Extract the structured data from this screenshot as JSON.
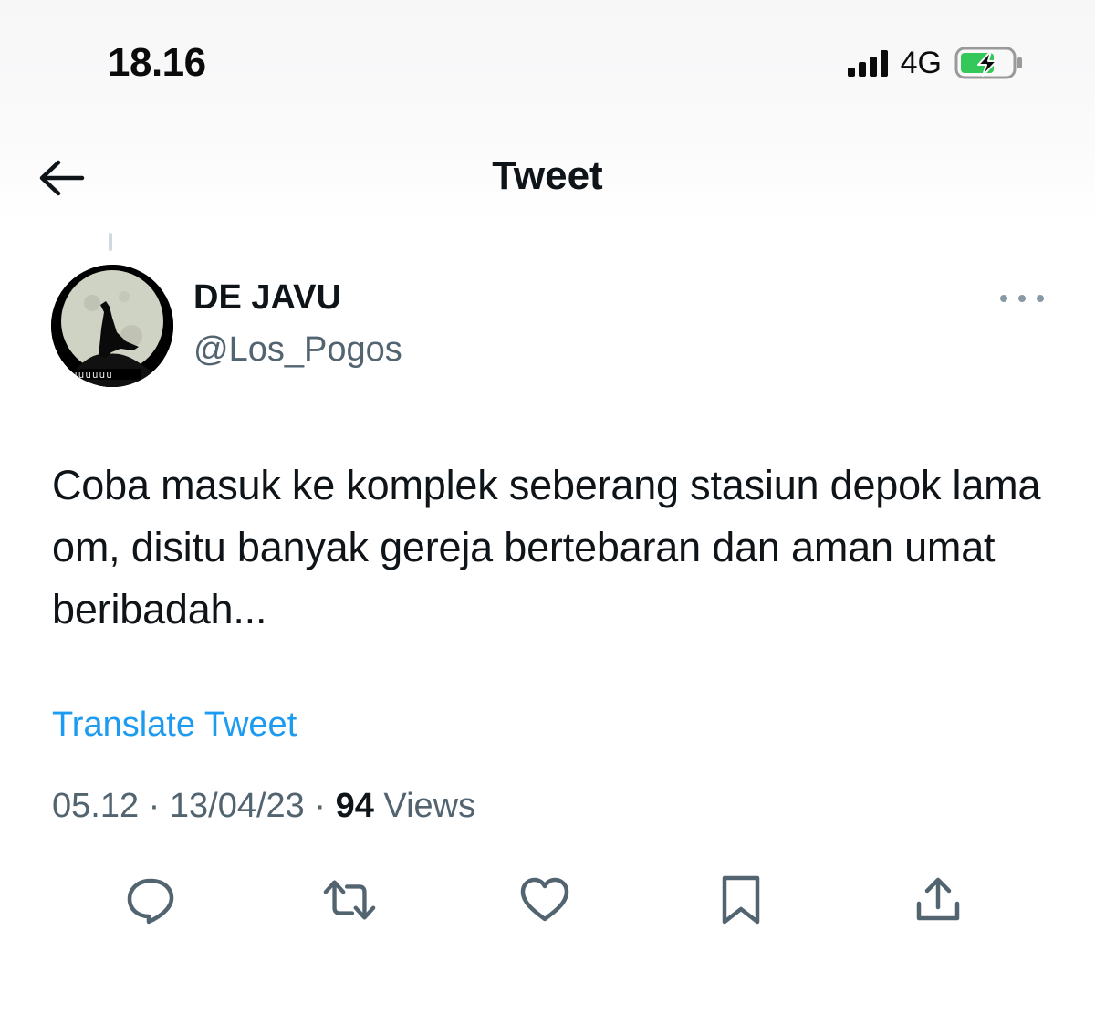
{
  "status_bar": {
    "time": "18.16",
    "network": "4G",
    "signal_icon": "cellular-signal-icon",
    "battery_icon": "battery-charging-icon",
    "battery_color": "#34c759"
  },
  "header": {
    "title": "Tweet",
    "back_icon": "back-arrow-icon"
  },
  "tweet": {
    "author_name": "DE JAVU",
    "author_handle": "@Los_Pogos",
    "avatar_icon": "howling-wolf-moon-avatar",
    "more_icon": "more-horizontal-icon",
    "text": "Coba masuk ke komplek seberang stasiun depok lama om, disitu banyak gereja bertebaran dan aman umat beribadah...",
    "translate_label": "Translate Tweet",
    "time": "05.12",
    "separator": " · ",
    "date": "13/04/23",
    "views_count": "94",
    "views_label": "Views"
  },
  "actions": [
    {
      "name": "reply",
      "icon": "reply-bubble-icon"
    },
    {
      "name": "retweet",
      "icon": "retweet-icon"
    },
    {
      "name": "like",
      "icon": "heart-icon"
    },
    {
      "name": "bookmark",
      "icon": "bookmark-icon"
    },
    {
      "name": "share",
      "icon": "share-upload-icon"
    }
  ],
  "colors": {
    "link": "#1d9bf0",
    "secondary_text": "#536471",
    "primary_text": "#0f1419",
    "icon": "#536471"
  }
}
